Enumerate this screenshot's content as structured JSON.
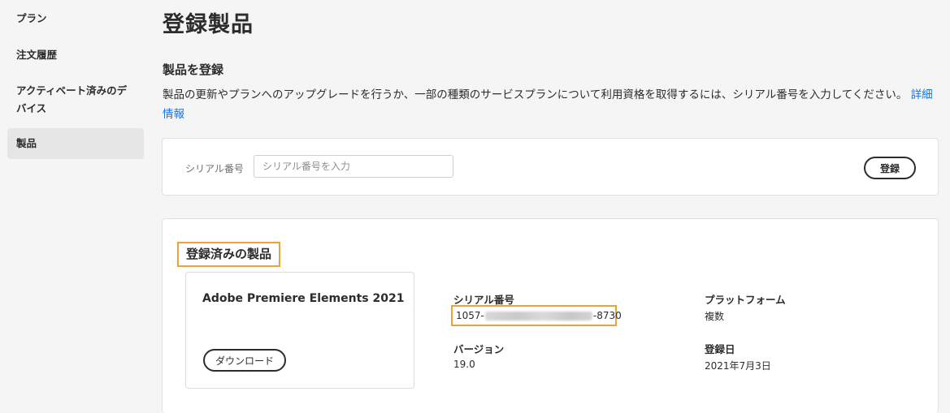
{
  "sidebar": {
    "items": [
      {
        "label": "プラン"
      },
      {
        "label": "注文履歴"
      },
      {
        "label": "アクティベート済みのデ"
      },
      {
        "label": "バイス"
      },
      {
        "label": "製品"
      }
    ]
  },
  "page": {
    "title": "登録製品"
  },
  "register": {
    "section_title": "製品を登録",
    "description": "製品の更新やプランへのアップグレードを行うか、一部の種類のサービスプランについて利用資格を取得するには、シリアル番号を入力してください。",
    "more_info_link": "詳細情報",
    "serial_label": "シリアル番号",
    "serial_placeholder": "シリアル番号を入力",
    "register_button": "登録"
  },
  "registered": {
    "heading": "登録済みの製品",
    "product": {
      "name": "Adobe Premiere Elements 2021",
      "download_button": "ダウンロード",
      "serial_label": "シリアル番号",
      "serial_prefix": "1057-",
      "serial_suffix": "-8730",
      "platform_label": "プラットフォーム",
      "platform_value": "複数",
      "version_label": "バージョン",
      "version_value": "19.0",
      "date_label": "登録日",
      "date_value": "2021年7月3日"
    }
  },
  "colors": {
    "accent_link": "#1473e6",
    "highlight_border": "#e8a33d",
    "background": "#f5f5f5"
  }
}
